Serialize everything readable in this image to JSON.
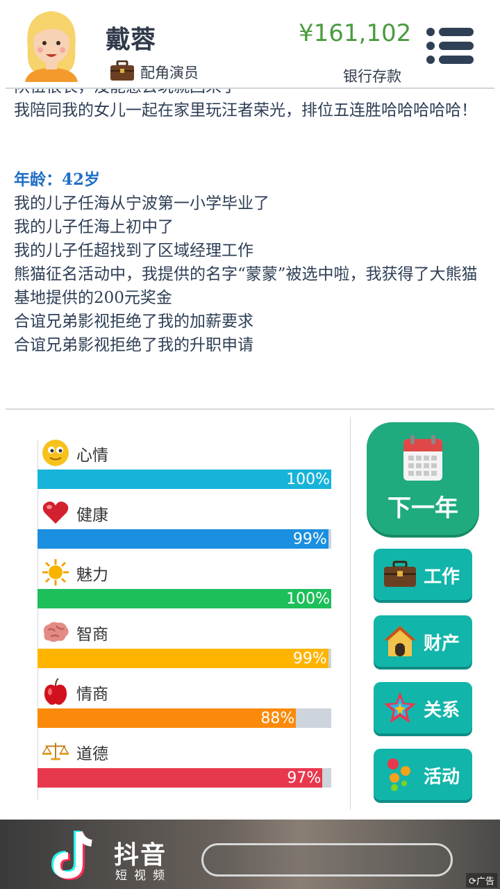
{
  "header": {
    "name": "戴蓉",
    "job_label": "配角演员",
    "money": "¥161,102",
    "money_label": "银行存款"
  },
  "log": {
    "lines_before": [
      "队伍很长，没能感去玩就回来了",
      "我陪同我的女儿一起在家里玩汪者荣光，排位五连胜哈哈哈哈哈！"
    ],
    "age_heading": "年龄：42岁",
    "lines_after": [
      "我的儿子任海从宁波第一小学毕业了",
      "我的儿子任海上初中了",
      "我的儿子任超找到了区域经理工作",
      "熊猫征名活动中，我提供的名字“蒙蒙”被选中啦，我获得了大熊猫基地提供的200元奖金",
      "合谊兄弟影视拒绝了我的加薪要求",
      "合谊兄弟影视拒绝了我的升职申请"
    ]
  },
  "stats": [
    {
      "label": "心情",
      "value": 100,
      "text": "100%",
      "color": "#17b3d9",
      "icon": "smiley-icon"
    },
    {
      "label": "健康",
      "value": 99,
      "text": "99%",
      "color": "#1b8fe0",
      "icon": "heart-icon"
    },
    {
      "label": "魅力",
      "value": 100,
      "text": "100%",
      "color": "#1dbf5a",
      "icon": "sun-icon"
    },
    {
      "label": "智商",
      "value": 99,
      "text": "99%",
      "color": "#ffb400",
      "icon": "brain-icon"
    },
    {
      "label": "情商",
      "value": 88,
      "text": "88%",
      "color": "#fb8a0a",
      "icon": "apple-icon"
    },
    {
      "label": "道德",
      "value": 97,
      "text": "97%",
      "color": "#e8384e",
      "icon": "scale-icon"
    }
  ],
  "buttons": {
    "next_year": "下一年",
    "work": "工作",
    "assets": "财产",
    "relations": "关系",
    "activities": "活动"
  },
  "ad": {
    "brand": "抖音",
    "sub": "短视频",
    "tag": "广告"
  }
}
